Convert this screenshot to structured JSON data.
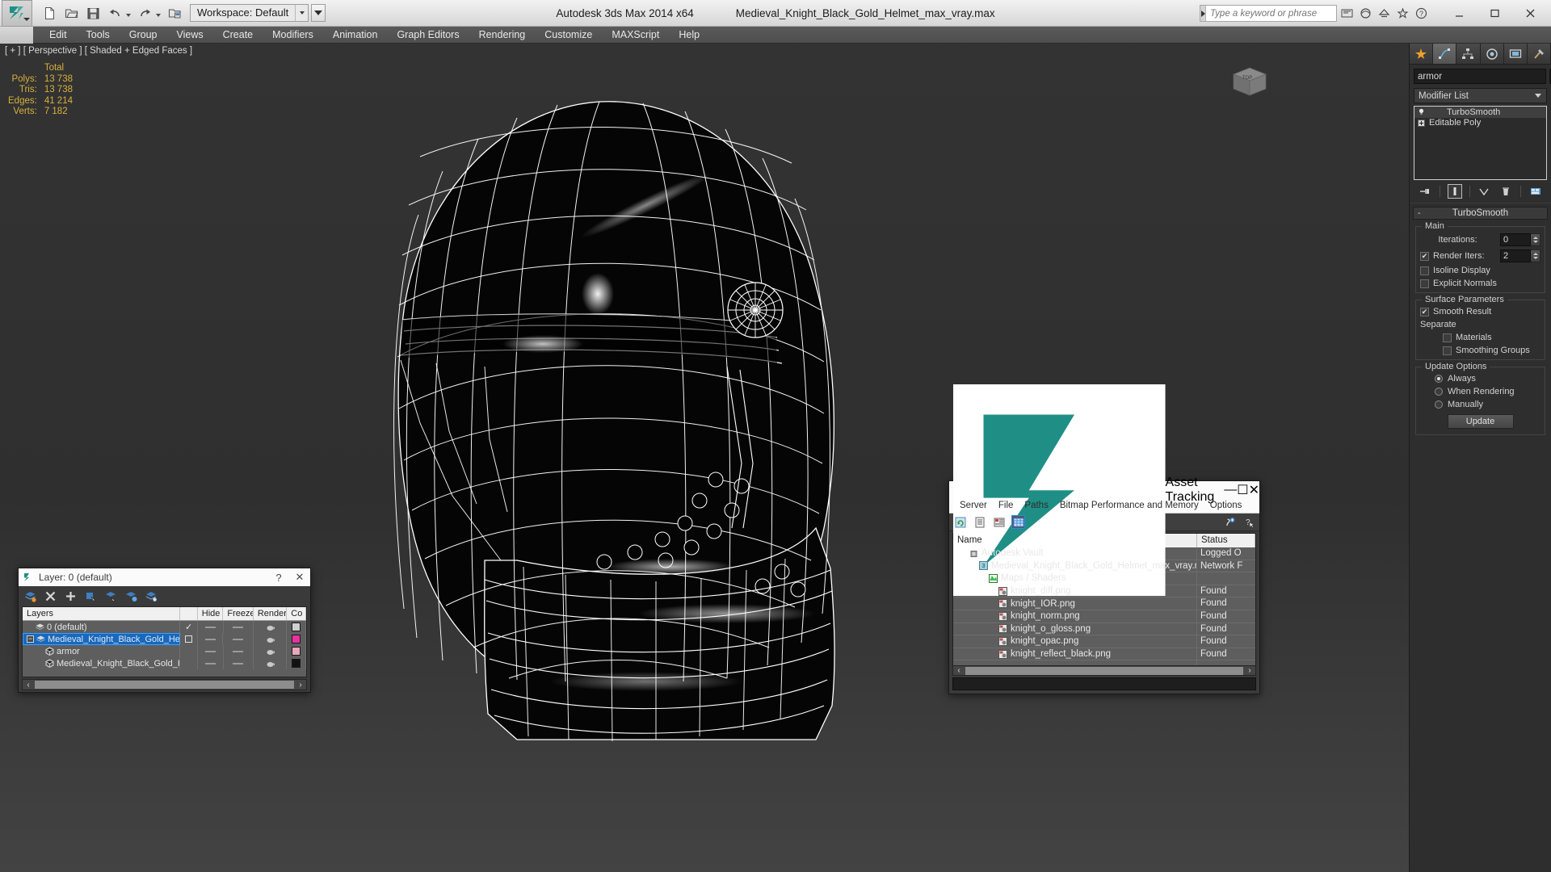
{
  "titlebar": {
    "app_title": "Autodesk 3ds Max  2014 x64",
    "file_title": "Medieval_Knight_Black_Gold_Helmet_max_vray.max",
    "workspace_label": "Workspace: Default",
    "search_placeholder": "Type a keyword or phrase",
    "quick_access": [
      {
        "name": "new-file-icon",
        "tip": "New"
      },
      {
        "name": "open-file-icon",
        "tip": "Open"
      },
      {
        "name": "save-file-icon",
        "tip": "Save"
      },
      {
        "name": "undo-icon",
        "tip": "Undo"
      },
      {
        "name": "redo-icon",
        "tip": "Redo"
      },
      {
        "name": "set-project-folder-icon",
        "tip": "Set Project Folder"
      }
    ],
    "right_icons": [
      {
        "name": "sign-in-icon"
      },
      {
        "name": "autodesk-360-icon"
      },
      {
        "name": "exchange-app-icon"
      },
      {
        "name": "favorites-star-icon"
      },
      {
        "name": "help-icon"
      }
    ],
    "window_buttons": {
      "minimize": "—",
      "maximize": "☐",
      "close": "✕"
    }
  },
  "menubar": {
    "items": [
      "Edit",
      "Tools",
      "Group",
      "Views",
      "Create",
      "Modifiers",
      "Animation",
      "Graph Editors",
      "Rendering",
      "Customize",
      "MAXScript",
      "Help"
    ]
  },
  "viewport": {
    "label": "[ + ] [ Perspective ] [ Shaded + Edged Faces ]",
    "stats": {
      "header": "Total",
      "rows": [
        {
          "label": "Polys:",
          "value": "13 738"
        },
        {
          "label": "Tris:",
          "value": "13 738"
        },
        {
          "label": "Edges:",
          "value": "41 214"
        },
        {
          "label": "Verts:",
          "value": "7 182"
        }
      ]
    },
    "background_color": "#2f2f2f",
    "wire_color": "#ffffff",
    "helper_color": "#e0538a"
  },
  "command_panel": {
    "tabs": [
      {
        "name": "create-tab",
        "icon": "star-icon",
        "active": false
      },
      {
        "name": "modify-tab",
        "icon": "curve-icon",
        "active": true
      },
      {
        "name": "hierarchy-tab",
        "icon": "hierarchy-icon",
        "active": false
      },
      {
        "name": "motion-tab",
        "icon": "wheel-icon",
        "active": false
      },
      {
        "name": "display-tab",
        "icon": "monitor-icon",
        "active": false
      },
      {
        "name": "utilities-tab",
        "icon": "hammer-icon",
        "active": false
      }
    ],
    "object_name": "armor",
    "object_color": "#e8c3cb",
    "modifier_list_label": "Modifier List",
    "stack": [
      {
        "label": "TurboSmooth",
        "icon": "lightbulb-icon",
        "selected": true
      },
      {
        "label": "Editable Poly",
        "icon": "plus-box-icon",
        "selected": false
      }
    ],
    "stack_buttons": [
      {
        "name": "pin-stack-button",
        "icon": "pin-icon"
      },
      {
        "name": "show-end-result-button",
        "icon": "bar-icon",
        "active": true
      },
      {
        "name": "make-unique-button",
        "icon": "chevron-down-icon"
      },
      {
        "name": "remove-modifier-button",
        "icon": "trash-icon"
      },
      {
        "name": "configure-modifier-sets-button",
        "icon": "config-icon"
      }
    ],
    "rollout": {
      "title": "TurboSmooth",
      "groups": [
        {
          "title": "Main",
          "fields": [
            {
              "type": "spinner",
              "label": "Iterations:",
              "value": "0",
              "checkbox": false
            },
            {
              "type": "spinner",
              "label": "Render Iters:",
              "value": "2",
              "checkbox": true,
              "checked": true
            },
            {
              "type": "checkbox",
              "label": "Isoline Display",
              "checked": false
            },
            {
              "type": "checkbox",
              "label": "Explicit Normals",
              "checked": false
            }
          ]
        },
        {
          "title": "Surface Parameters",
          "fields": [
            {
              "type": "checkbox",
              "label": "Smooth Result",
              "checked": true
            },
            {
              "type": "text",
              "label": "Separate"
            },
            {
              "type": "checkbox",
              "label": "Materials",
              "checked": false,
              "indent": true
            },
            {
              "type": "checkbox",
              "label": "Smoothing Groups",
              "checked": false,
              "indent": true
            }
          ]
        },
        {
          "title": "Update Options",
          "fields": [
            {
              "type": "radio",
              "label": "Always",
              "checked": true
            },
            {
              "type": "radio",
              "label": "When Rendering",
              "checked": false
            },
            {
              "type": "radio",
              "label": "Manually",
              "checked": false
            }
          ],
          "button": "Update"
        }
      ]
    }
  },
  "layer_dialog": {
    "title": "Layer: 0 (default)",
    "help_btn": "?",
    "close_btn": "✕",
    "toolbar": [
      {
        "name": "create-new-layer-button",
        "icon": "layer-new-icon"
      },
      {
        "name": "delete-layer-button",
        "icon": "x-icon"
      },
      {
        "name": "add-layer-button",
        "icon": "plus-icon"
      },
      {
        "name": "select-objects-in-layer-button",
        "icon": "layer-select-icon"
      },
      {
        "name": "select-highlighted-objects-button",
        "icon": "layer-cursor-icon"
      },
      {
        "name": "add-selection-to-layer-button",
        "icon": "layer-add-icon"
      },
      {
        "name": "set-current-layer-button",
        "icon": "layer-set-icon"
      }
    ],
    "columns": [
      "Layers",
      "",
      "Hide",
      "Freeze",
      "Render",
      "Co"
    ],
    "rows": [
      {
        "name": "0 (default)",
        "icon": "layer-icon",
        "indent": 1,
        "expander": false,
        "current": true,
        "selected": false,
        "hide": "dash",
        "freeze": "dash",
        "render": "teapot",
        "color": "#cfcfcf"
      },
      {
        "name": "Medieval_Knight_Black_Gold_Helmet",
        "icon": "layer-icon",
        "indent": 0,
        "expander": true,
        "current": false,
        "selected": true,
        "hide": "dash",
        "freeze": "dash",
        "render": "teapot",
        "color": "#e832a0"
      },
      {
        "name": "armor",
        "icon": "object-icon",
        "indent": 2,
        "expander": false,
        "current": false,
        "selected": false,
        "hide": "dash",
        "freeze": "dash",
        "render": "teapot",
        "color": "#e8a8bc"
      },
      {
        "name": "Medieval_Knight_Black_Gold_Helmet",
        "icon": "object-icon",
        "indent": 2,
        "expander": false,
        "current": false,
        "selected": false,
        "hide": "dash",
        "freeze": "dash",
        "render": "teapot",
        "color": "#111111"
      }
    ],
    "scroll": {
      "left_arrow": "‹",
      "right_arrow": "›"
    }
  },
  "asset_dialog": {
    "title": "Asset Tracking",
    "window_buttons": {
      "minimize": "—",
      "maximize": "☐",
      "close": "✕"
    },
    "menu": [
      "Server",
      "File",
      "Paths",
      "Bitmap Performance and Memory",
      "Options"
    ],
    "toolbar": [
      {
        "name": "refresh-icon",
        "active": false
      },
      {
        "name": "list-view-icon",
        "active": false
      },
      {
        "name": "detail-view-icon",
        "active": false
      },
      {
        "name": "grid-view-icon",
        "active": true
      }
    ],
    "toolbar_right": [
      {
        "name": "add-help-icon"
      },
      {
        "name": "context-help-icon"
      }
    ],
    "columns": [
      "Name",
      "Status"
    ],
    "rows": [
      {
        "name": "Autodesk Vault",
        "status": "Logged O",
        "indent": 1,
        "icon": "vault-icon"
      },
      {
        "name": "Medieval_Knight_Black_Gold_Helmet_max_vray.max",
        "status": "Network F",
        "indent": 2,
        "icon": "max-file-icon"
      },
      {
        "name": "Maps / Shaders",
        "status": "",
        "indent": 3,
        "icon": "maps-icon"
      },
      {
        "name": "knight_diff.png",
        "status": "Found",
        "indent": 4,
        "icon": "bitmap-icon"
      },
      {
        "name": "knight_IOR.png",
        "status": "Found",
        "indent": 4,
        "icon": "bitmap-icon"
      },
      {
        "name": "knight_norm.png",
        "status": "Found",
        "indent": 4,
        "icon": "bitmap-icon"
      },
      {
        "name": "knight_o_gloss.png",
        "status": "Found",
        "indent": 4,
        "icon": "bitmap-icon"
      },
      {
        "name": "knight_opac.png",
        "status": "Found",
        "indent": 4,
        "icon": "bitmap-icon"
      },
      {
        "name": "knight_reflect_black.png",
        "status": "Found",
        "indent": 4,
        "icon": "bitmap-icon"
      }
    ],
    "scroll": {
      "left_arrow": "‹",
      "right_arrow": "›"
    }
  }
}
